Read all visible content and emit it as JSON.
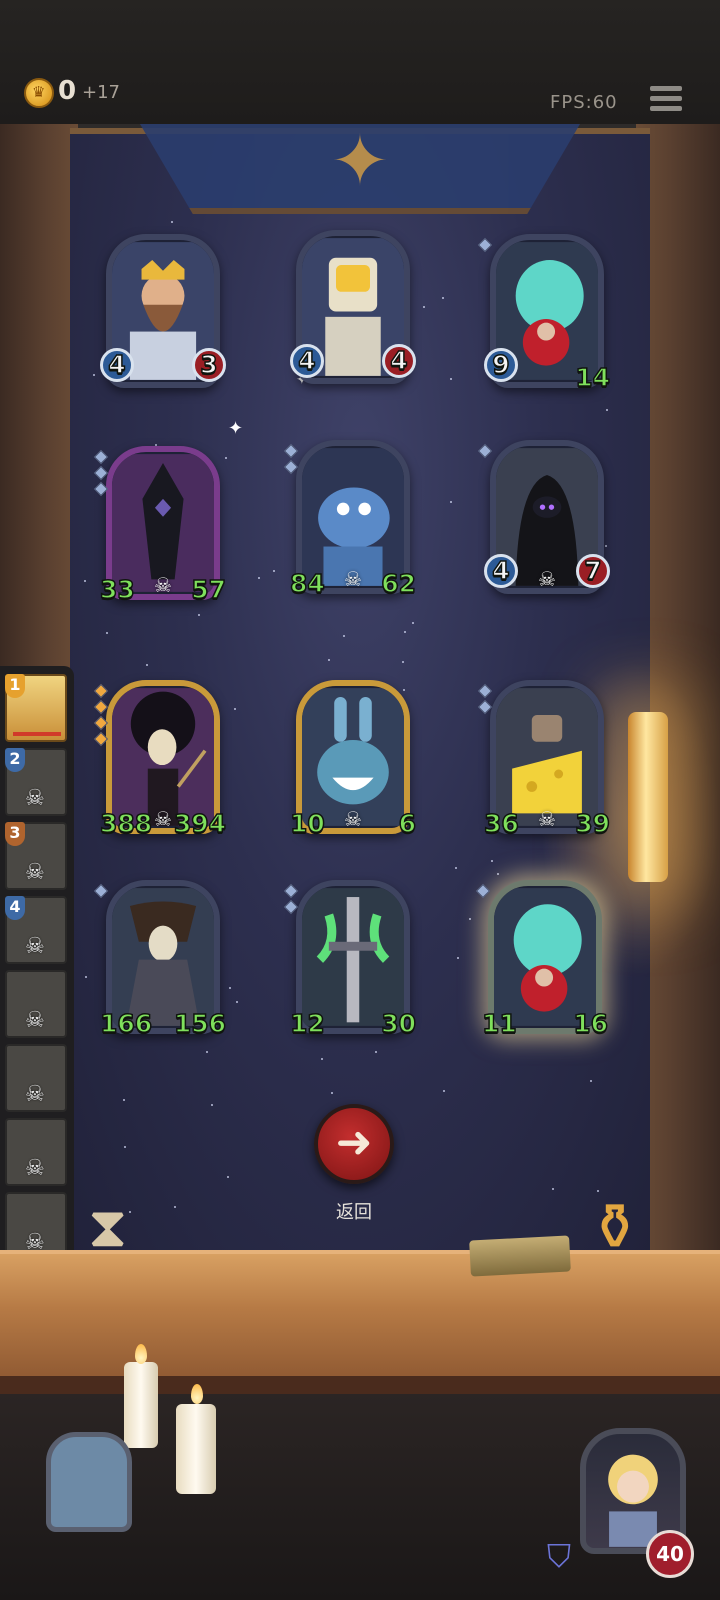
{
  "header": {
    "coins": "0",
    "coin_bonus": "+17",
    "fps": "FPS:60"
  },
  "colors": {
    "sky": "#2d2f4f",
    "attack_badge": "#2c5a96",
    "health_badge": "#9a1e24",
    "stat_green": "#7fe05c",
    "back_button": "#c32e2e"
  },
  "cards": [
    {
      "name": "king",
      "attack": "4",
      "health": "3",
      "style": "badge"
    },
    {
      "name": "golden-robot",
      "attack": "4",
      "health": "4",
      "style": "badge"
    },
    {
      "name": "ghost-giant",
      "attack": "9",
      "health": "14",
      "style": "badge-green"
    },
    {
      "name": "dark-knight",
      "attack": "33",
      "health": "57",
      "style": "green"
    },
    {
      "name": "blue-dragon",
      "attack": "84",
      "health": "62",
      "style": "green"
    },
    {
      "name": "hooded-shadow",
      "attack": "4",
      "health": "7",
      "style": "badge"
    },
    {
      "name": "skeleton-mage",
      "attack": "388",
      "health": "394",
      "style": "green"
    },
    {
      "name": "bunny-robot",
      "attack": "10",
      "health": "6",
      "style": "green"
    },
    {
      "name": "cheese-golem",
      "attack": "36",
      "health": "39",
      "style": "green"
    },
    {
      "name": "reaper",
      "attack": "166",
      "health": "156",
      "style": "green"
    },
    {
      "name": "cursed-sword",
      "attack": "12",
      "health": "30",
      "style": "green"
    },
    {
      "name": "ghost-giant-2",
      "attack": "11",
      "health": "16",
      "style": "green"
    }
  ],
  "sidebar": [
    {
      "rank": "1"
    },
    {
      "rank": "2"
    },
    {
      "rank": "3"
    },
    {
      "rank": "4"
    },
    {
      "rank": ""
    },
    {
      "rank": ""
    },
    {
      "rank": ""
    },
    {
      "rank": ""
    }
  ],
  "back_label": "返回",
  "player": {
    "health": "40"
  }
}
